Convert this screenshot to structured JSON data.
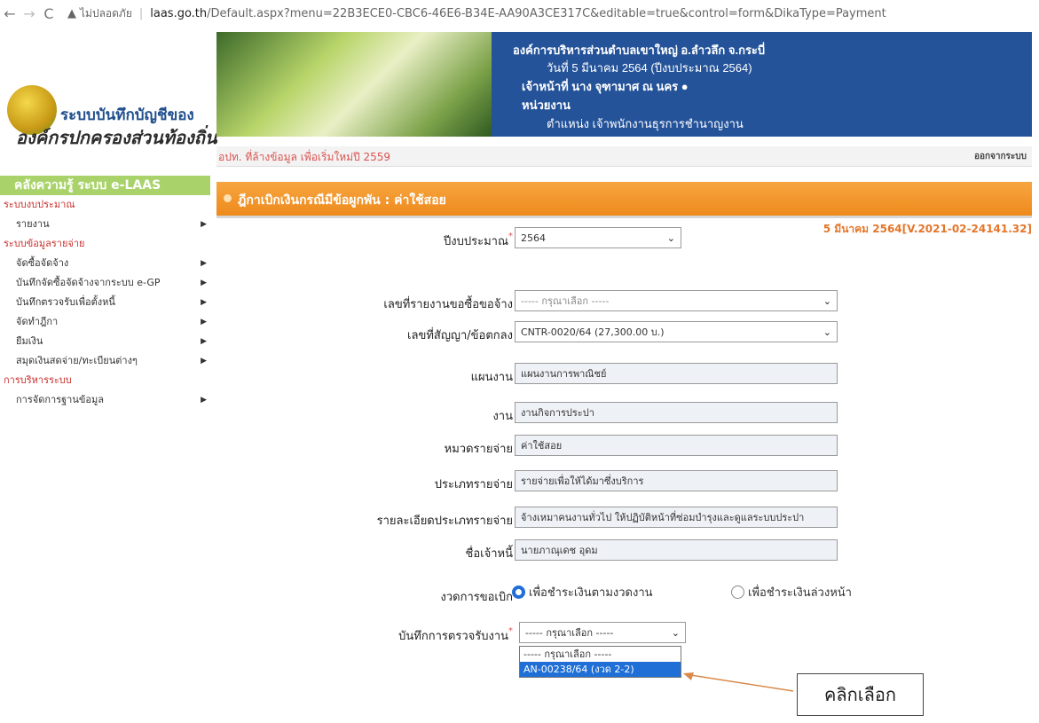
{
  "browser": {
    "back": "←",
    "forward": "→",
    "reload": "C",
    "security_label": "ไม่ปลอดภัย",
    "url_domain": "laas.go.th",
    "url_path": "/Default.aspx?menu=22B3ECE0-CBC6-46E6-B34E-AA90A3CE317C&editable=true&control=form&DikaType=Payment"
  },
  "header": {
    "logo_line1": "ระบบบันทึกบัญชีของ",
    "logo_line2": "องค์กรปกครองส่วนท้องถิ่น",
    "org_name": "องค์การบริหารส่วนตำบลเขาใหญ่ อ.ลำวลึก จ.กระบี่",
    "date_line": "วันที่ 5 มีนาคม 2564  (ปีงบประมาณ 2564)",
    "officer_line": "เจ้าหน้าที่ นาง จุฑามาศ ณ นคร",
    "unit_line": "หน่วยงาน",
    "position_line": "ตำแหน่ง เจ้าพนักงานธุรการชำนาญงาน"
  },
  "subbar": {
    "notice": "อปท. ที่ล้างข้อมูล เพื่อเริ่มใหม่ปี 2559",
    "logout": "ออกจากระบบ"
  },
  "sidebar": {
    "kb_banner": "คลังความรู้ ระบบ e-LAAS",
    "sections": [
      {
        "heading": "ระบบงบประมาณ",
        "items": [
          "รายงาน"
        ]
      },
      {
        "heading": "ระบบข้อมูลรายจ่าย",
        "items": [
          "จัดซื้อจัดจ้าง",
          "บันทึกจัดซื้อจัดจ้างจากระบบ e-GP",
          "บันทึกตรวจรับเพื่อตั้งหนี้",
          "จัดทำฎีกา",
          "ยืมเงิน",
          "สมุดเงินสดจ่าย/ทะเบียนต่างๆ"
        ]
      },
      {
        "heading": "การบริหารระบบ",
        "items": [
          "การจัดการฐานข้อมูล"
        ]
      }
    ]
  },
  "page": {
    "title": "ฎีกาเบิกเงินกรณีมีข้อผูกพัน : ค่าใช้สอย",
    "version": "5 มีนาคม 2564[V.2021-02-24141.32]"
  },
  "form": {
    "fiscal_year": {
      "label": "ปีงบประมาณ",
      "value": "2564"
    },
    "purchase_report": {
      "label": "เลขที่รายงานขอซื้อขอจ้าง",
      "value": "----- กรุณาเลือก -----"
    },
    "contract": {
      "label": "เลขที่สัญญา/ข้อตกลง",
      "value": "CNTR-0020/64 (27,300.00 บ.)"
    },
    "plan": {
      "label": "แผนงาน",
      "value": "แผนงานการพาณิชย์"
    },
    "work": {
      "label": "งาน",
      "value": "งานกิจการประปา"
    },
    "category": {
      "label": "หมวดรายจ่าย",
      "value": "ค่าใช้สอย"
    },
    "type": {
      "label": "ประเภทรายจ่าย",
      "value": "รายจ่ายเพื่อให้ได้มาซึ่งบริการ"
    },
    "type_detail": {
      "label": "รายละเอียดประเภทรายจ่าย",
      "value": "จ้างเหมาคนงานทั่วไป ให้ปฏิบัติหน้าที่ซ่อมบำรุงและดูแลระบบประปา"
    },
    "creditor": {
      "label": "ชื่อเจ้าหนี้",
      "value": "นายภาณุเดช อุดม"
    },
    "installment": {
      "label": "งวดการขอเบิก",
      "option1": "เพื่อชำระเงินตามงวดงาน",
      "option2": "เพื่อชำระเงินล่วงหน้า"
    },
    "inspection": {
      "label": "บันทึกการตรวจรับงาน",
      "value": "----- กรุณาเลือก -----",
      "options": [
        "----- กรุณาเลือก -----",
        "AN-00238/64 (งวด 2-2)"
      ]
    }
  },
  "annotation": {
    "callout": "คลิกเลือก"
  },
  "colors": {
    "header_blue": "#24539a",
    "title_orange": "#ee8a1c",
    "accent_red": "#d9534f",
    "selection_blue": "#1f6fd6"
  }
}
